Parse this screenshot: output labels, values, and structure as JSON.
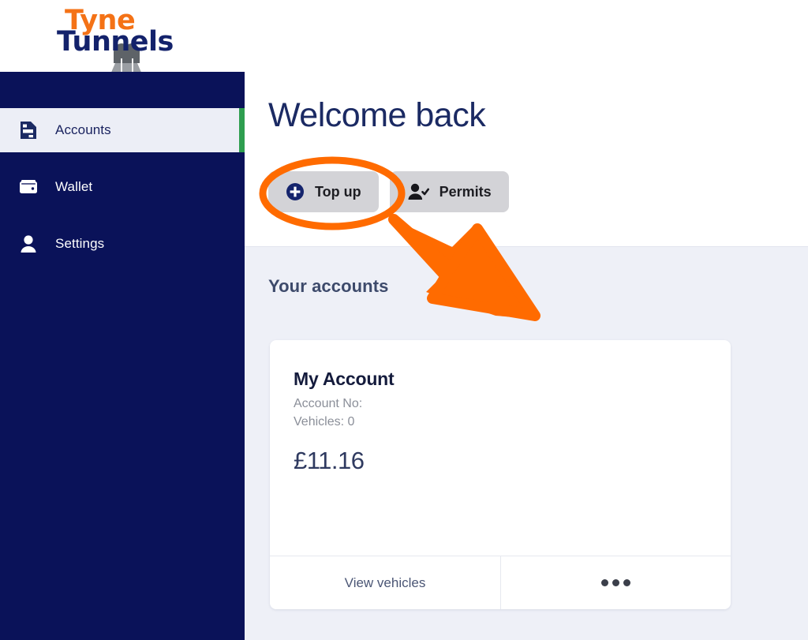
{
  "brand": {
    "name_top": "Tyne",
    "name_bottom": "Tunnels",
    "logo_icon": "tunnel-road-logo"
  },
  "sidebar": {
    "items": [
      {
        "label": "Accounts",
        "icon": "document-icon",
        "active": true
      },
      {
        "label": "Wallet",
        "icon": "wallet-icon",
        "active": false
      },
      {
        "label": "Settings",
        "icon": "user-icon",
        "active": false
      }
    ],
    "active_accent_color": "#2e9e4f",
    "background_color": "#0a1259"
  },
  "header": {
    "title": "Welcome back",
    "buttons": [
      {
        "label": "Top up",
        "icon": "plus-circle-icon"
      },
      {
        "label": "Permits",
        "icon": "user-check-icon"
      }
    ]
  },
  "main": {
    "section_title": "Your accounts",
    "background_color": "#eef0f7"
  },
  "account_card": {
    "title": "My Account",
    "account_no_label": "Account No:",
    "vehicles_label": "Vehicles: 0",
    "balance": "£11.16",
    "footer": {
      "view_vehicles_label": "View vehicles",
      "more_icon": "ellipsis-icon"
    }
  },
  "annotations": {
    "color": "#ff6b00",
    "highlight_shape": "ellipse-around-top-up-button",
    "pointer_shape": "arrow-pointing-to-top-up-button"
  }
}
